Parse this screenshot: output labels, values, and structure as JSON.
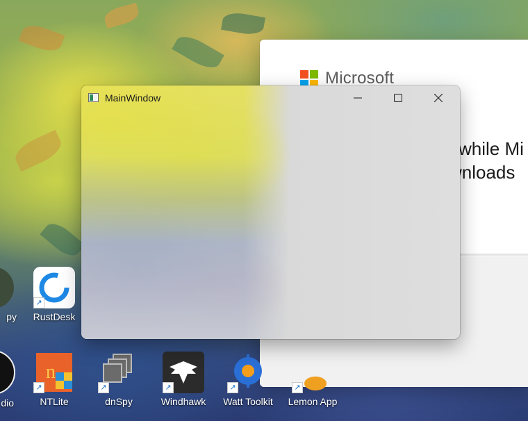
{
  "desktop": {
    "icons": [
      {
        "label": "RustDesk",
        "icon": "rustdesk-icon"
      },
      {
        "label": "NTLite",
        "icon": "ntlite-icon"
      },
      {
        "label": "dnSpy",
        "icon": "dnspy-icon"
      },
      {
        "label": "Windhawk",
        "icon": "windhawk-icon"
      },
      {
        "label": "Watt Toolkit",
        "icon": "watt-toolkit-icon"
      },
      {
        "label": "Lemon App",
        "icon": "lemon-app-icon"
      }
    ],
    "partial_labels": [
      "py",
      "dio"
    ]
  },
  "ms_window": {
    "brand": "Microsoft",
    "line1": "while Mi",
    "line2": "wnloads",
    "logo_colors": [
      "#f25022",
      "#7fba00",
      "#00a4ef",
      "#ffb900"
    ]
  },
  "main_window": {
    "title": "MainWindow",
    "minimize_icon": "minimize-icon",
    "maximize_icon": "maximize-icon",
    "close_icon": "close-icon"
  }
}
